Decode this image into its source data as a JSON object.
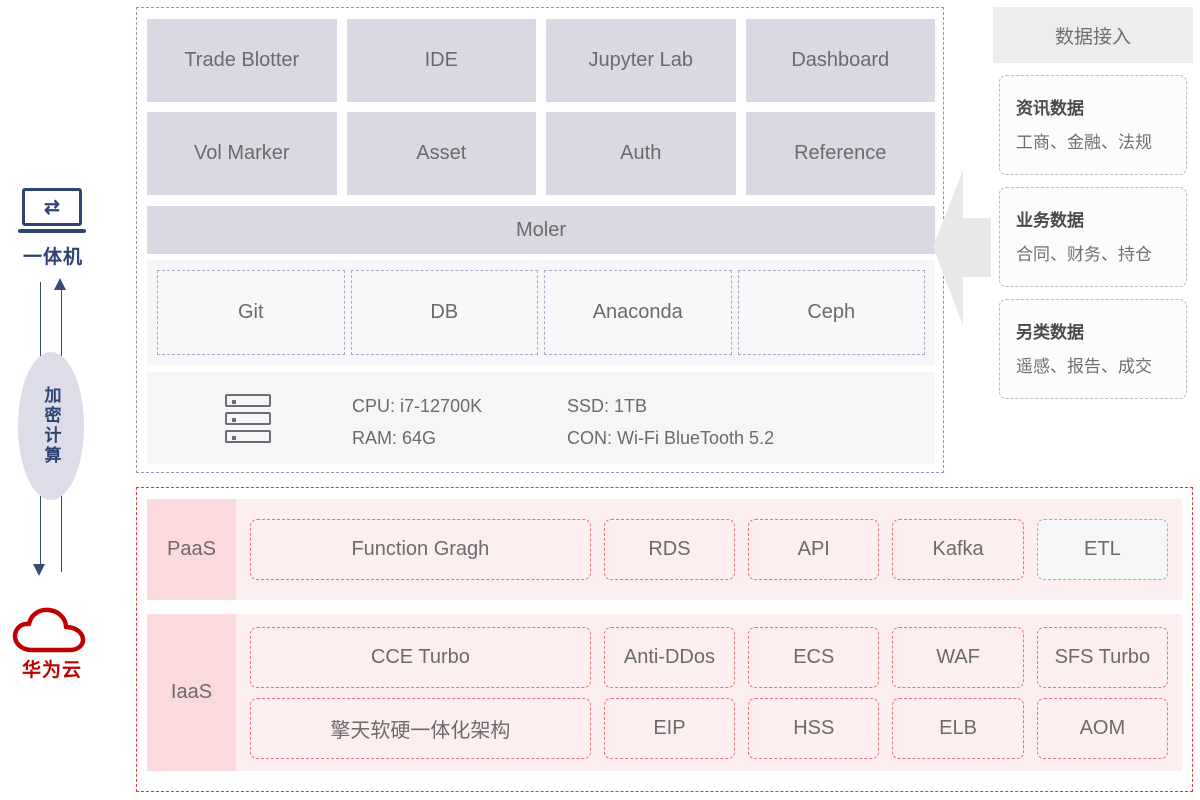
{
  "left_rail": {
    "device_icon": "laptop-sync-icon",
    "device_label": "一体机",
    "middle_label": "加密计算",
    "cloud_icon": "cloud-icon",
    "cloud_label": "华为云",
    "arrow_up": "arrow-up-icon",
    "arrow_down": "arrow-down-icon"
  },
  "main_panel": {
    "apps": [
      "Trade Blotter",
      "IDE",
      "Jupyter Lab",
      "Dashboard",
      "Vol Marker",
      "Asset",
      "Auth",
      "Reference"
    ],
    "platform_bar": "Moler",
    "components": [
      "Git",
      "DB",
      "Anaconda",
      "Ceph"
    ],
    "hardware": {
      "icon": "server-icon",
      "specs": [
        {
          "label": "CPU:",
          "value": "i7-12700K"
        },
        {
          "label": "SSD:",
          "value": "1TB"
        },
        {
          "label": "RAM:",
          "value": "64G"
        },
        {
          "label": "CON:",
          "value": "Wi-Fi   BlueTooth 5.2"
        }
      ]
    }
  },
  "data_sidebar": {
    "title": "数据接入",
    "feed_arrow": "arrow-left-icon",
    "cards": [
      {
        "title": "资讯数据",
        "subtitle": "工商、金融、法规"
      },
      {
        "title": "业务数据",
        "subtitle": "合同、财务、持仓"
      },
      {
        "title": "另类数据",
        "subtitle": "遥感、报告、成交"
      }
    ]
  },
  "cloud_panel": {
    "rows": [
      {
        "label": "PaaS",
        "lines": [
          [
            {
              "text": "Function Gragh",
              "width": "wide",
              "variant": "red"
            },
            {
              "text": "RDS",
              "width": "norm",
              "variant": "red"
            },
            {
              "text": "API",
              "width": "norm",
              "variant": "red"
            },
            {
              "text": "Kafka",
              "width": "norm",
              "variant": "red"
            },
            {
              "text": "ETL",
              "width": "norm",
              "variant": "blue"
            }
          ]
        ]
      },
      {
        "label": "IaaS",
        "lines": [
          [
            {
              "text": "CCE Turbo",
              "width": "wide",
              "variant": "red"
            },
            {
              "text": "Anti-DDos",
              "width": "norm",
              "variant": "red"
            },
            {
              "text": "ECS",
              "width": "norm",
              "variant": "red"
            },
            {
              "text": "WAF",
              "width": "norm",
              "variant": "red"
            },
            {
              "text": "SFS Turbo",
              "width": "norm",
              "variant": "red"
            }
          ],
          [
            {
              "text": "擎天软硬一体化架构",
              "width": "wide",
              "variant": "red"
            },
            {
              "text": "EIP",
              "width": "norm",
              "variant": "red"
            },
            {
              "text": "HSS",
              "width": "norm",
              "variant": "red"
            },
            {
              "text": "ELB",
              "width": "norm",
              "variant": "red"
            },
            {
              "text": "AOM",
              "width": "norm",
              "variant": "red"
            }
          ]
        ]
      }
    ]
  },
  "colors": {
    "navy": "#2e4372",
    "huawei_red": "#c00000",
    "app_card": "#d8d9e3",
    "panel_dash": "#8e93b8",
    "cloud_dash": "#e0393e",
    "svc_box": "#fdeef0",
    "svc_label": "#fadadd",
    "etl_dash": "#a8a9c0"
  }
}
